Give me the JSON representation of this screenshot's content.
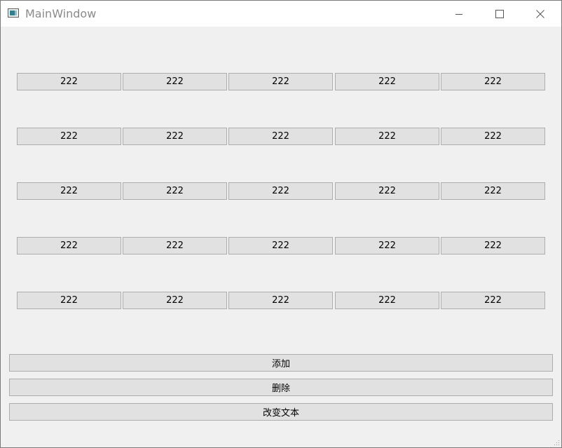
{
  "window": {
    "title": "MainWindow"
  },
  "grid": {
    "rows": [
      [
        "222",
        "222",
        "222",
        "222",
        "222"
      ],
      [
        "222",
        "222",
        "222",
        "222",
        "222"
      ],
      [
        "222",
        "222",
        "222",
        "222",
        "222"
      ],
      [
        "222",
        "222",
        "222",
        "222",
        "222"
      ],
      [
        "222",
        "222",
        "222",
        "222",
        "222"
      ]
    ]
  },
  "actions": {
    "add_label": "添加",
    "delete_label": "删除",
    "change_text_label": "改变文本"
  }
}
